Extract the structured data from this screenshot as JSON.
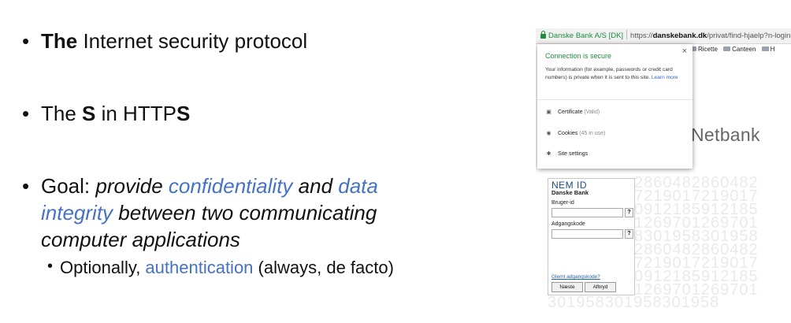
{
  "slide": {
    "bullet1": {
      "bold": "The",
      "rest": " Internet security protocol"
    },
    "bullet2": {
      "pre": "The ",
      "bold1": "S",
      "mid": " in HTTP",
      "bold2": "S"
    },
    "bullet3": {
      "lead": "Goal: ",
      "part1": "provide ",
      "link1": "confidentiality",
      "part2": " and ",
      "link2": "data",
      "line2_link": "integrity",
      "line2_rest": " between two communicating",
      "line3": "computer applications"
    },
    "subbullet": {
      "pre": "Optionally, ",
      "link": "authentication",
      "post": " (always, de facto)"
    }
  },
  "browser": {
    "site_identity": "Danske Bank A/S [DK]",
    "url_domain_pre": "https://",
    "url_domain": "danskebank.dk",
    "url_path": "/privat/find-hjaelp?n-login",
    "bookmarks": [
      "Ricette",
      "Canteen",
      "H"
    ],
    "popup": {
      "title": "Connection is secure",
      "close": "×",
      "body": "Your information (for example, passwords or credit card numbers) is private when it is sent to this site.",
      "learn_more": "Learn more",
      "certificate_label": "Certificate",
      "certificate_status": "(Valid)",
      "cookies_label": "Cookies",
      "cookies_status": "(45 in use)",
      "site_settings": "Site settings"
    },
    "netbank": "Netbank",
    "nemid": {
      "logo": "NEM ID",
      "bank": "Danske Bank",
      "user_label": "Bruger-id",
      "pass_label": "Adgangskode",
      "help": "?",
      "forgot": "Glemt adgangskode?",
      "next": "Næste",
      "cancel": "Afbryd"
    },
    "digit_rows": [
      "2860482860482",
      "7219017219017",
      "0912185912185",
      "1269701269701",
      "8301958301958",
      "2860482860482",
      "7219017219017",
      "0912185912185",
      "1269701269701"
    ],
    "digit_bottom": "301958301958301958"
  }
}
